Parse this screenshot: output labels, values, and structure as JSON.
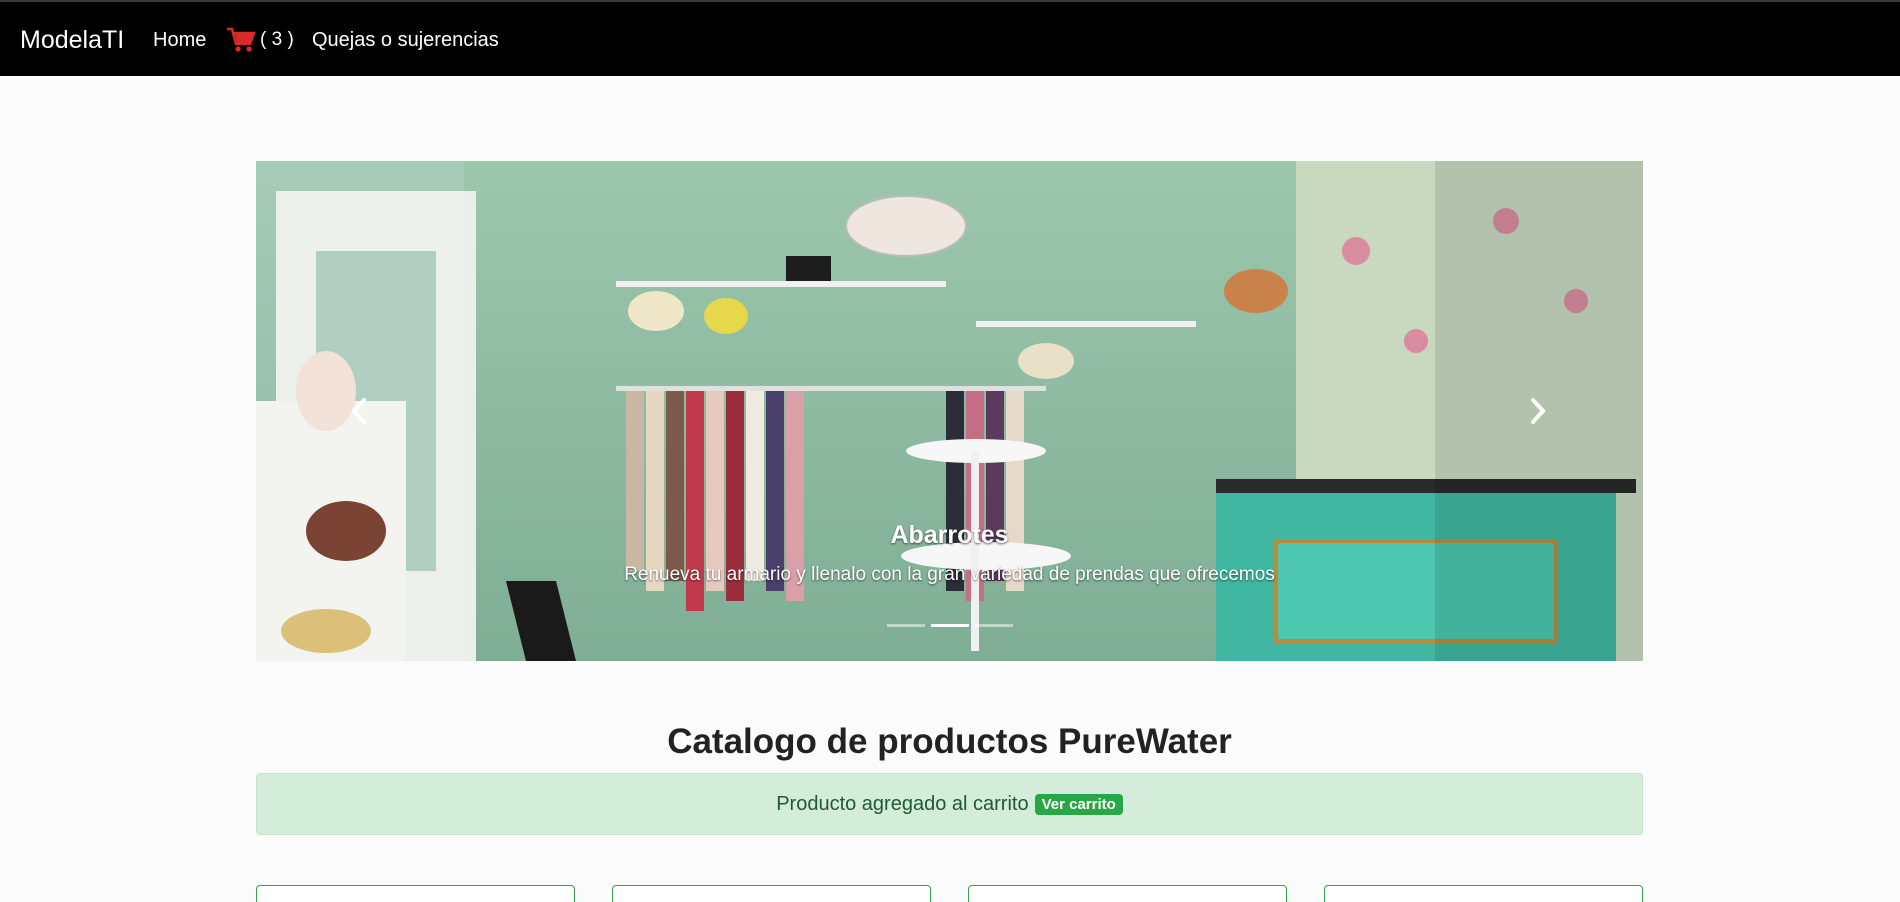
{
  "navbar": {
    "brand": "ModelaTI",
    "home_label": "Home",
    "cart_icon": "shopping-cart-icon",
    "cart_count": "( 3 )",
    "quejas_label": "Quejas o sujerencias"
  },
  "carousel": {
    "caption_title": "Abarrotes",
    "caption_text": "Renueva tu armario y llenalo con la gran variedad de prendas que ofrecemos",
    "indicators": 3,
    "active_indicator": 2,
    "prev_icon": "chevron-left-icon",
    "next_icon": "chevron-right-icon"
  },
  "catalog": {
    "title": "Catalogo de productos PureWater",
    "alert_text": "Producto agregado al carrito",
    "alert_badge": "Ver carrito"
  },
  "colors": {
    "navbar_bg": "#000000",
    "alert_bg": "#d4ecda",
    "badge_bg": "#2aa745",
    "card_border": "#32a24f"
  }
}
